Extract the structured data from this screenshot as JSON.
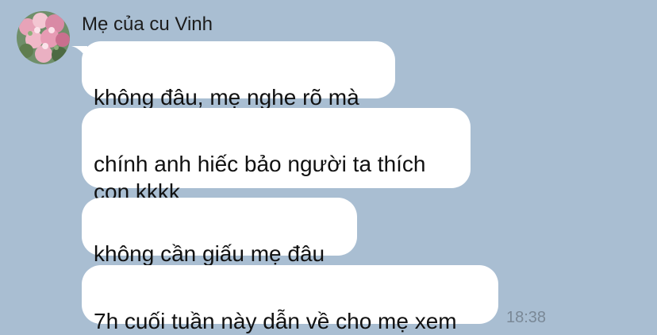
{
  "contact": {
    "name": "Mẹ của cu Vinh",
    "avatar_icon": "flower-bouquet-avatar"
  },
  "messages": [
    {
      "text": "không đâu, mẹ nghe rõ mà"
    },
    {
      "text": "chính anh hiếc bảo người ta thích\ncon kkkk"
    },
    {
      "text": "không cần giấu mẹ đâu"
    },
    {
      "text": "7h cuối tuần này dẫn về cho mẹ xem"
    }
  ],
  "timestamp": "18:38",
  "colors": {
    "background": "#a9bed2",
    "bubble": "#ffffff",
    "timestamp": "#7a8896"
  }
}
